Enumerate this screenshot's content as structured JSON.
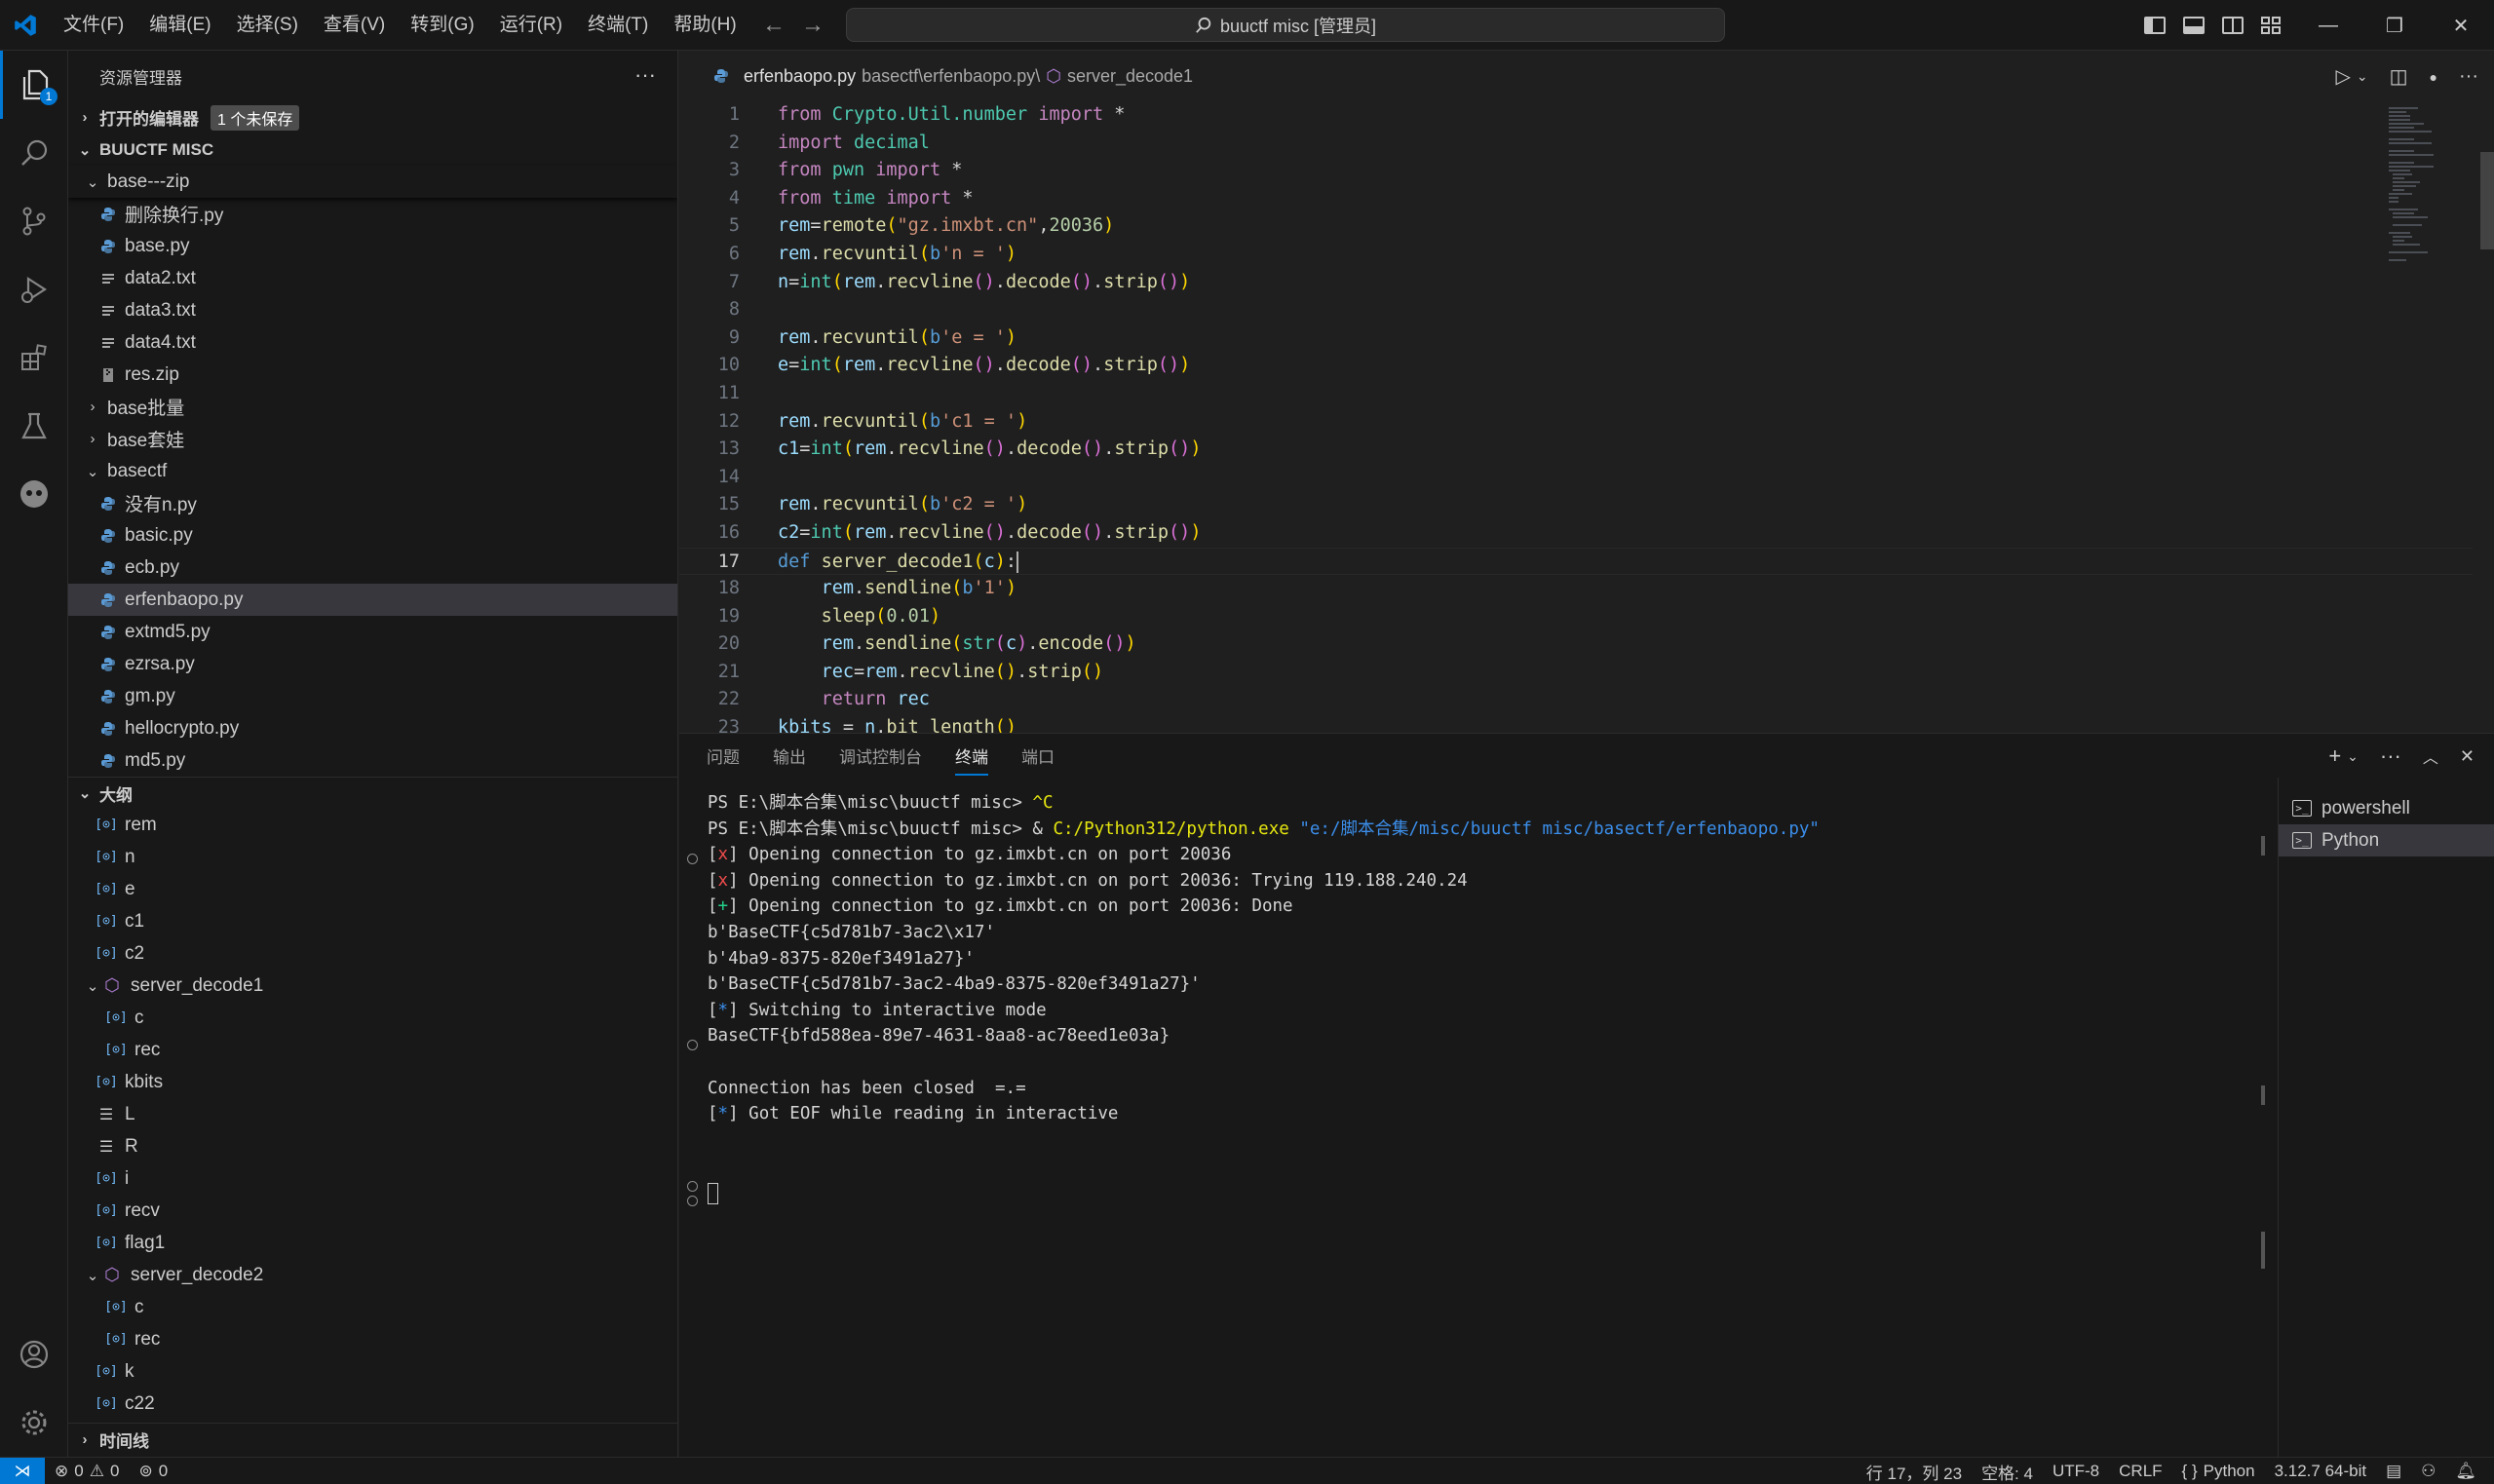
{
  "titlebar": {
    "menu": [
      "文件(F)",
      "编辑(E)",
      "选择(S)",
      "查看(V)",
      "转到(G)",
      "运行(R)",
      "终端(T)",
      "帮助(H)"
    ],
    "search_text": "buuctf misc [管理员]"
  },
  "activitybar": {
    "explorer_badge": "1"
  },
  "sidebar": {
    "title": "资源管理器",
    "open_editors_label": "打开的编辑器",
    "unsaved_badge": "1 个未保存",
    "workspace_label": "BUUCTF MISC",
    "tree": [
      {
        "label": "base---zip",
        "type": "folder",
        "open": true,
        "indent": 1
      },
      {
        "label": "删除换行.py",
        "type": "py",
        "indent": 2
      },
      {
        "label": "base.py",
        "type": "py",
        "indent": 2
      },
      {
        "label": "data2.txt",
        "type": "txt",
        "indent": 2
      },
      {
        "label": "data3.txt",
        "type": "txt",
        "indent": 2
      },
      {
        "label": "data4.txt",
        "type": "txt",
        "indent": 2
      },
      {
        "label": "res.zip",
        "type": "zip",
        "indent": 2
      },
      {
        "label": "base批量",
        "type": "folder",
        "open": false,
        "indent": 1
      },
      {
        "label": "base套娃",
        "type": "folder",
        "open": false,
        "indent": 1
      },
      {
        "label": "basectf",
        "type": "folder",
        "open": true,
        "indent": 1
      },
      {
        "label": "没有n.py",
        "type": "py",
        "indent": 2
      },
      {
        "label": "basic.py",
        "type": "py",
        "indent": 2
      },
      {
        "label": "ecb.py",
        "type": "py",
        "indent": 2
      },
      {
        "label": "erfenbaopo.py",
        "type": "py",
        "indent": 2,
        "selected": true
      },
      {
        "label": "extmd5.py",
        "type": "py",
        "indent": 2
      },
      {
        "label": "ezrsa.py",
        "type": "py",
        "indent": 2
      },
      {
        "label": "gm.py",
        "type": "py",
        "indent": 2
      },
      {
        "label": "hellocrypto.py",
        "type": "py",
        "indent": 2
      },
      {
        "label": "md5.py",
        "type": "py",
        "indent": 2
      }
    ],
    "outline_label": "大纲",
    "outline": [
      {
        "label": "rem",
        "kind": "var",
        "indent": 1
      },
      {
        "label": "n",
        "kind": "var",
        "indent": 1
      },
      {
        "label": "e",
        "kind": "var",
        "indent": 1
      },
      {
        "label": "c1",
        "kind": "var",
        "indent": 1
      },
      {
        "label": "c2",
        "kind": "var",
        "indent": 1
      },
      {
        "label": "server_decode1",
        "kind": "func",
        "indent": 1,
        "open": true
      },
      {
        "label": "c",
        "kind": "var",
        "indent": 2
      },
      {
        "label": "rec",
        "kind": "var",
        "indent": 2
      },
      {
        "label": "kbits",
        "kind": "var",
        "indent": 1
      },
      {
        "label": "L",
        "kind": "list",
        "indent": 1
      },
      {
        "label": "R",
        "kind": "list",
        "indent": 1
      },
      {
        "label": "i",
        "kind": "var",
        "indent": 1
      },
      {
        "label": "recv",
        "kind": "var",
        "indent": 1
      },
      {
        "label": "flag1",
        "kind": "var",
        "indent": 1
      },
      {
        "label": "server_decode2",
        "kind": "func",
        "indent": 1,
        "open": true
      },
      {
        "label": "c",
        "kind": "var",
        "indent": 2
      },
      {
        "label": "rec",
        "kind": "var",
        "indent": 2
      },
      {
        "label": "k",
        "kind": "var",
        "indent": 1
      },
      {
        "label": "c22",
        "kind": "var",
        "indent": 1
      }
    ],
    "timeline_label": "时间线"
  },
  "editor": {
    "filename": "erfenbaopo.py",
    "breadcrumb_path": "basectf\\erfenbaopo.py\\",
    "breadcrumb_symbol": "server_decode1",
    "current_line": 17,
    "lines": [
      [
        [
          "kw",
          "from "
        ],
        [
          "mod",
          "Crypto.Util.number "
        ],
        [
          "kw",
          "import "
        ],
        [
          "pl",
          "*"
        ]
      ],
      [
        [
          "kw",
          "import "
        ],
        [
          "mod",
          "decimal"
        ]
      ],
      [
        [
          "kw",
          "from "
        ],
        [
          "mod",
          "pwn "
        ],
        [
          "kw",
          "import "
        ],
        [
          "pl",
          "*"
        ]
      ],
      [
        [
          "kw",
          "from "
        ],
        [
          "mod",
          "time "
        ],
        [
          "kw",
          "import "
        ],
        [
          "pl",
          "*"
        ]
      ],
      [
        [
          "var",
          "rem"
        ],
        [
          "pl",
          "="
        ],
        [
          "fn",
          "remote"
        ],
        [
          "br1",
          "("
        ],
        [
          "str",
          "\"gz.imxbt.cn\""
        ],
        [
          "pl",
          ","
        ],
        [
          "num",
          "20036"
        ],
        [
          "br1",
          ")"
        ]
      ],
      [
        [
          "var",
          "rem"
        ],
        [
          "pl",
          "."
        ],
        [
          "fn",
          "recvuntil"
        ],
        [
          "br1",
          "("
        ],
        [
          "kw2",
          "b"
        ],
        [
          "str",
          "'n = '"
        ],
        [
          "br1",
          ")"
        ]
      ],
      [
        [
          "var",
          "n"
        ],
        [
          "pl",
          "="
        ],
        [
          "mod",
          "int"
        ],
        [
          "br1",
          "("
        ],
        [
          "var",
          "rem"
        ],
        [
          "pl",
          "."
        ],
        [
          "fn",
          "recvline"
        ],
        [
          "br2",
          "()"
        ],
        [
          "pl",
          "."
        ],
        [
          "fn",
          "decode"
        ],
        [
          "br2",
          "()"
        ],
        [
          "pl",
          "."
        ],
        [
          "fn",
          "strip"
        ],
        [
          "br2",
          "()"
        ],
        [
          "br1",
          ")"
        ]
      ],
      [],
      [
        [
          "var",
          "rem"
        ],
        [
          "pl",
          "."
        ],
        [
          "fn",
          "recvuntil"
        ],
        [
          "br1",
          "("
        ],
        [
          "kw2",
          "b"
        ],
        [
          "str",
          "'e = '"
        ],
        [
          "br1",
          ")"
        ]
      ],
      [
        [
          "var",
          "e"
        ],
        [
          "pl",
          "="
        ],
        [
          "mod",
          "int"
        ],
        [
          "br1",
          "("
        ],
        [
          "var",
          "rem"
        ],
        [
          "pl",
          "."
        ],
        [
          "fn",
          "recvline"
        ],
        [
          "br2",
          "()"
        ],
        [
          "pl",
          "."
        ],
        [
          "fn",
          "decode"
        ],
        [
          "br2",
          "()"
        ],
        [
          "pl",
          "."
        ],
        [
          "fn",
          "strip"
        ],
        [
          "br2",
          "()"
        ],
        [
          "br1",
          ")"
        ]
      ],
      [],
      [
        [
          "var",
          "rem"
        ],
        [
          "pl",
          "."
        ],
        [
          "fn",
          "recvuntil"
        ],
        [
          "br1",
          "("
        ],
        [
          "kw2",
          "b"
        ],
        [
          "str",
          "'c1 = '"
        ],
        [
          "br1",
          ")"
        ]
      ],
      [
        [
          "var",
          "c1"
        ],
        [
          "pl",
          "="
        ],
        [
          "mod",
          "int"
        ],
        [
          "br1",
          "("
        ],
        [
          "var",
          "rem"
        ],
        [
          "pl",
          "."
        ],
        [
          "fn",
          "recvline"
        ],
        [
          "br2",
          "()"
        ],
        [
          "pl",
          "."
        ],
        [
          "fn",
          "decode"
        ],
        [
          "br2",
          "()"
        ],
        [
          "pl",
          "."
        ],
        [
          "fn",
          "strip"
        ],
        [
          "br2",
          "()"
        ],
        [
          "br1",
          ")"
        ]
      ],
      [],
      [
        [
          "var",
          "rem"
        ],
        [
          "pl",
          "."
        ],
        [
          "fn",
          "recvuntil"
        ],
        [
          "br1",
          "("
        ],
        [
          "kw2",
          "b"
        ],
        [
          "str",
          "'c2 = '"
        ],
        [
          "br1",
          ")"
        ]
      ],
      [
        [
          "var",
          "c2"
        ],
        [
          "pl",
          "="
        ],
        [
          "mod",
          "int"
        ],
        [
          "br1",
          "("
        ],
        [
          "var",
          "rem"
        ],
        [
          "pl",
          "."
        ],
        [
          "fn",
          "recvline"
        ],
        [
          "br2",
          "()"
        ],
        [
          "pl",
          "."
        ],
        [
          "fn",
          "decode"
        ],
        [
          "br2",
          "()"
        ],
        [
          "pl",
          "."
        ],
        [
          "fn",
          "strip"
        ],
        [
          "br2",
          "()"
        ],
        [
          "br1",
          ")"
        ]
      ],
      [
        [
          "kw2",
          "def "
        ],
        [
          "fn",
          "server_decode1"
        ],
        [
          "br1",
          "("
        ],
        [
          "var",
          "c"
        ],
        [
          "br1",
          ")"
        ],
        [
          "pl",
          ":"
        ]
      ],
      [
        [
          "pl",
          "    "
        ],
        [
          "var",
          "rem"
        ],
        [
          "pl",
          "."
        ],
        [
          "fn",
          "sendline"
        ],
        [
          "br1",
          "("
        ],
        [
          "kw2",
          "b"
        ],
        [
          "str",
          "'1'"
        ],
        [
          "br1",
          ")"
        ]
      ],
      [
        [
          "pl",
          "    "
        ],
        [
          "fn",
          "sleep"
        ],
        [
          "br1",
          "("
        ],
        [
          "num",
          "0.01"
        ],
        [
          "br1",
          ")"
        ]
      ],
      [
        [
          "pl",
          "    "
        ],
        [
          "var",
          "rem"
        ],
        [
          "pl",
          "."
        ],
        [
          "fn",
          "sendline"
        ],
        [
          "br1",
          "("
        ],
        [
          "mod",
          "str"
        ],
        [
          "br2",
          "("
        ],
        [
          "var",
          "c"
        ],
        [
          "br2",
          ")"
        ],
        [
          "pl",
          "."
        ],
        [
          "fn",
          "encode"
        ],
        [
          "br2",
          "()"
        ],
        [
          "br1",
          ")"
        ]
      ],
      [
        [
          "pl",
          "    "
        ],
        [
          "var",
          "rec"
        ],
        [
          "pl",
          "="
        ],
        [
          "var",
          "rem"
        ],
        [
          "pl",
          "."
        ],
        [
          "fn",
          "recvline"
        ],
        [
          "br1",
          "()"
        ],
        [
          "pl",
          "."
        ],
        [
          "fn",
          "strip"
        ],
        [
          "br1",
          "()"
        ]
      ],
      [
        [
          "pl",
          "    "
        ],
        [
          "kw",
          "return "
        ],
        [
          "var",
          "rec"
        ]
      ],
      [
        [
          "var",
          "kbits"
        ],
        [
          "pl",
          " = "
        ],
        [
          "var",
          "n"
        ],
        [
          "pl",
          "."
        ],
        [
          "fn",
          "bit_length"
        ],
        [
          "br1",
          "()"
        ]
      ]
    ]
  },
  "panel": {
    "tabs": [
      "问题",
      "输出",
      "调试控制台",
      "终端",
      "端口"
    ],
    "active_tab": 3,
    "terminal_lines": [
      [
        [
          "pl",
          "PS E:\\脚本合集\\misc\\buuctf misc> "
        ],
        [
          "t-yellow",
          "^C"
        ]
      ],
      [
        [
          "pl",
          "PS E:\\脚本合集\\misc\\buuctf misc> & "
        ],
        [
          "t-exe",
          "C:/Python312/python.exe"
        ],
        [
          "pl",
          " "
        ],
        [
          "t-str",
          "\"e:/脚本合集/misc/buuctf misc/basectf/erfenbaopo.py\""
        ]
      ],
      [
        [
          "pl",
          "["
        ],
        [
          "t-red",
          "x"
        ],
        [
          "pl",
          "] Opening connection to gz.imxbt.cn on port 20036"
        ]
      ],
      [
        [
          "pl",
          "["
        ],
        [
          "t-red",
          "x"
        ],
        [
          "pl",
          "] Opening connection to gz.imxbt.cn on port 20036: Trying 119.188.240.24"
        ]
      ],
      [
        [
          "pl",
          "["
        ],
        [
          "t-green",
          "+"
        ],
        [
          "pl",
          "] Opening connection to gz.imxbt.cn on port 20036: Done"
        ]
      ],
      [
        [
          "pl",
          "b'BaseCTF{c5d781b7-3ac2\\x17'"
        ]
      ],
      [
        [
          "pl",
          "b'4ba9-8375-820ef3491a27}'"
        ]
      ],
      [
        [
          "pl",
          "b'BaseCTF{c5d781b7-3ac2-4ba9-8375-820ef3491a27}'"
        ]
      ],
      [
        [
          "pl",
          "["
        ],
        [
          "t-blue",
          "*"
        ],
        [
          "pl",
          "] Switching to interactive mode"
        ]
      ],
      [
        [
          "pl",
          "BaseCTF{bfd588ea-89e7-4631-8aa8-ac78eed1e03a}"
        ]
      ],
      [],
      [
        [
          "pl",
          "Connection has been closed  =.="
        ]
      ],
      [
        [
          "pl",
          "["
        ],
        [
          "t-blue",
          "*"
        ],
        [
          "pl",
          "] Got EOF while reading in interactive"
        ]
      ]
    ],
    "terminals": [
      "powershell",
      "Python"
    ]
  },
  "statusbar": {
    "errors": "0",
    "warnings": "0",
    "ports": "0",
    "position": "行 17，列 23",
    "spaces": "空格: 4",
    "encoding": "UTF-8",
    "eol": "CRLF",
    "language": "Python",
    "interpreter": "3.12.7 64-bit"
  }
}
